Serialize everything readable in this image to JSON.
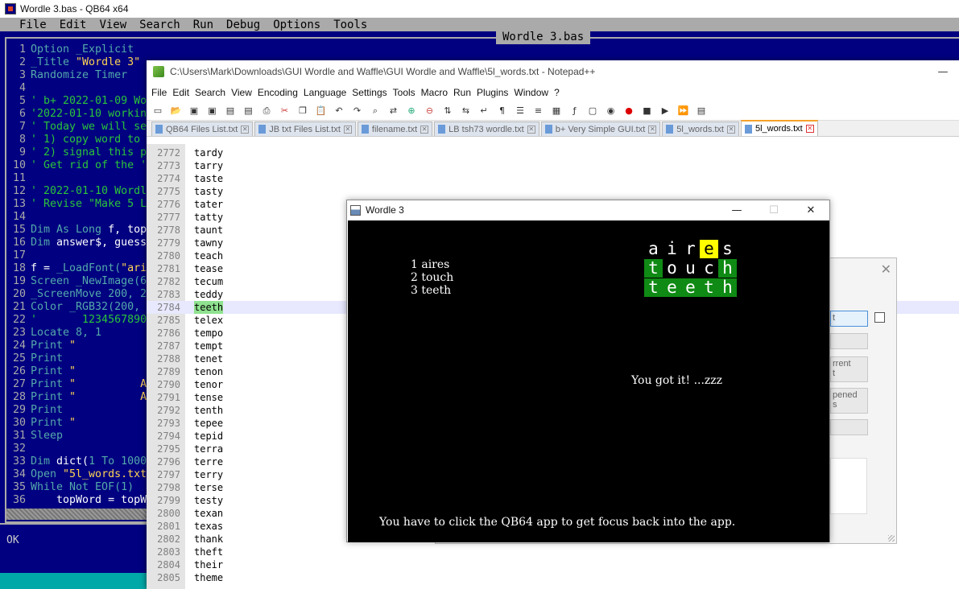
{
  "qb64": {
    "title": "Wordle 3.bas - QB64 x64",
    "menu": [
      "File",
      "Edit",
      "View",
      "Search",
      "Run",
      "Debug",
      "Options",
      "Tools"
    ],
    "file_title": "Wordle 3.bas",
    "status": "OK",
    "code_lines": [
      {
        "n": "1",
        "segs": [
          {
            "c": "kw",
            "t": "Option _Explicit"
          }
        ]
      },
      {
        "n": "2",
        "segs": [
          {
            "c": "kw",
            "t": "_Title "
          },
          {
            "c": "st",
            "t": "\"Wordle 3\""
          }
        ]
      },
      {
        "n": "3",
        "segs": [
          {
            "c": "kw",
            "t": "Randomize Timer"
          }
        ]
      },
      {
        "n": "4",
        "segs": []
      },
      {
        "n": "5",
        "segs": [
          {
            "c": "cm",
            "t": "' b+ 2022-01-09 Wo"
          }
        ]
      },
      {
        "n": "6",
        "segs": [
          {
            "c": "cm",
            "t": "'2022-01-10 workin"
          }
        ]
      },
      {
        "n": "7",
        "segs": [
          {
            "c": "cm",
            "t": "' Today we will se"
          }
        ]
      },
      {
        "n": "8",
        "segs": [
          {
            "c": "cm",
            "t": "' 1) copy word to"
          }
        ]
      },
      {
        "n": "9",
        "segs": [
          {
            "c": "cm",
            "t": "' 2) signal this p"
          }
        ]
      },
      {
        "n": "10",
        "segs": [
          {
            "c": "cm",
            "t": "' Get rid of the '"
          }
        ]
      },
      {
        "n": "11",
        "segs": []
      },
      {
        "n": "12",
        "segs": [
          {
            "c": "cm",
            "t": "' 2022-01-10 Wordl"
          }
        ]
      },
      {
        "n": "13",
        "segs": [
          {
            "c": "cm",
            "t": "' Revise \"Make 5 L"
          }
        ]
      },
      {
        "n": "14",
        "segs": []
      },
      {
        "n": "15",
        "segs": [
          {
            "c": "kw",
            "t": "Dim As Long "
          },
          {
            "c": "nm",
            "t": "f, top"
          }
        ]
      },
      {
        "n": "16",
        "segs": [
          {
            "c": "kw",
            "t": "Dim "
          },
          {
            "c": "nm",
            "t": "answer$, guess"
          }
        ]
      },
      {
        "n": "17",
        "segs": []
      },
      {
        "n": "18",
        "segs": [
          {
            "c": "nm",
            "t": "f = "
          },
          {
            "c": "kw",
            "t": "_LoadFont("
          },
          {
            "c": "st",
            "t": "\"ari"
          }
        ]
      },
      {
        "n": "19",
        "segs": [
          {
            "c": "kw",
            "t": "Screen _NewImage(6"
          }
        ]
      },
      {
        "n": "20",
        "segs": [
          {
            "c": "kw",
            "t": "_ScreenMove 200, 2"
          }
        ]
      },
      {
        "n": "21",
        "segs": [
          {
            "c": "kw",
            "t": "Color _RGB32(200, "
          }
        ]
      },
      {
        "n": "22",
        "segs": [
          {
            "c": "cm",
            "t": "'       12345678901"
          }
        ]
      },
      {
        "n": "23",
        "segs": [
          {
            "c": "kw",
            "t": "Locate 8, 1"
          }
        ]
      },
      {
        "n": "24",
        "segs": [
          {
            "c": "kw",
            "t": "Print "
          },
          {
            "c": "st",
            "t": "\""
          }
        ]
      },
      {
        "n": "25",
        "segs": [
          {
            "c": "kw",
            "t": "Print"
          }
        ]
      },
      {
        "n": "26",
        "segs": [
          {
            "c": "kw",
            "t": "Print "
          },
          {
            "c": "st",
            "t": "\""
          }
        ]
      },
      {
        "n": "27",
        "segs": [
          {
            "c": "kw",
            "t": "Print "
          },
          {
            "c": "st",
            "t": "\"          A"
          }
        ]
      },
      {
        "n": "28",
        "segs": [
          {
            "c": "kw",
            "t": "Print "
          },
          {
            "c": "st",
            "t": "\"          A"
          }
        ]
      },
      {
        "n": "29",
        "segs": [
          {
            "c": "kw",
            "t": "Print"
          }
        ]
      },
      {
        "n": "30",
        "segs": [
          {
            "c": "kw",
            "t": "Print "
          },
          {
            "c": "st",
            "t": "\""
          }
        ]
      },
      {
        "n": "31",
        "segs": [
          {
            "c": "kw",
            "t": "Sleep"
          }
        ]
      },
      {
        "n": "32",
        "segs": []
      },
      {
        "n": "33",
        "segs": [
          {
            "c": "kw",
            "t": "Dim "
          },
          {
            "c": "nm",
            "t": "dict("
          },
          {
            "c": "kw",
            "t": "1 To 1000"
          }
        ]
      },
      {
        "n": "34",
        "segs": [
          {
            "c": "kw",
            "t": "Open "
          },
          {
            "c": "st",
            "t": "\"5l_words.txt"
          }
        ]
      },
      {
        "n": "35",
        "segs": [
          {
            "c": "kw",
            "t": "While Not EOF(1)"
          }
        ]
      },
      {
        "n": "36",
        "segs": [
          {
            "c": "nm",
            "t": "    topWord = topW"
          }
        ]
      }
    ]
  },
  "npp": {
    "title": "C:\\Users\\Mark\\Downloads\\GUI Wordle and Waffle\\GUI Wordle and Waffle\\5l_words.txt - Notepad++",
    "minimize": "—",
    "menu": [
      "File",
      "Edit",
      "Search",
      "View",
      "Encoding",
      "Language",
      "Settings",
      "Tools",
      "Macro",
      "Run",
      "Plugins",
      "Window",
      "?"
    ],
    "toolbar_icons": [
      "new-icon",
      "open-icon",
      "save-icon",
      "save-all-icon",
      "close-icon",
      "close-all-icon",
      "print-icon",
      "cut-icon",
      "copy-icon",
      "paste-icon",
      "undo-icon",
      "redo-icon",
      "find-icon",
      "replace-icon",
      "zoom-in-icon",
      "zoom-out-icon",
      "sync-v-icon",
      "sync-h-icon",
      "wrap-icon",
      "all-chars-icon",
      "indent-guide-icon",
      "lang-icon",
      "doc-map-icon",
      "func-list-icon",
      "folder-icon",
      "monitor-icon",
      "record-icon",
      "stop-icon",
      "play-icon",
      "play-multi-icon",
      "save-macro-icon"
    ],
    "tabs": [
      {
        "label": "QB64 Files List.txt",
        "active": false
      },
      {
        "label": "JB txt Files List.txt",
        "active": false
      },
      {
        "label": "filename.txt",
        "active": false
      },
      {
        "label": "LB tsh73 wordle.txt",
        "active": false
      },
      {
        "label": "b+ Very Simple GUI.txt",
        "active": false
      },
      {
        "label": "5l_words.txt",
        "active": false
      },
      {
        "label": "5l_words.txt",
        "active": true
      }
    ],
    "first_line": 2772,
    "current_line": 2784,
    "lines": [
      "tardy",
      "tarry",
      "taste",
      "tasty",
      "tater",
      "tatty",
      "taunt",
      "tawny",
      "teach",
      "tease",
      "tecum",
      "teddy",
      "teeth",
      "telex",
      "tempo",
      "tempt",
      "tenet",
      "tenon",
      "tenor",
      "tense",
      "tenth",
      "tepee",
      "tepid",
      "terra",
      "terre",
      "terry",
      "terse",
      "testy",
      "texan",
      "texas",
      "thank",
      "theft",
      "their",
      "theme"
    ]
  },
  "dialog": {
    "buttons": [
      "t",
      "",
      "rrent\nt",
      "pened\ns",
      ""
    ]
  },
  "wordle": {
    "title": "Wordle 3",
    "guesses": [
      "1 aires",
      "2 touch",
      "3 teeth"
    ],
    "grid": [
      {
        "letters": [
          "a",
          "i",
          "r",
          "e",
          "s"
        ],
        "marks": [
          "none",
          "none",
          "none",
          "yellow",
          "none"
        ]
      },
      {
        "letters": [
          "t",
          "o",
          "u",
          "c",
          "h"
        ],
        "marks": [
          "green",
          "none",
          "none",
          "none",
          "green"
        ]
      },
      {
        "letters": [
          "t",
          "e",
          "e",
          "t",
          "h"
        ],
        "marks": [
          "green",
          "green",
          "green",
          "green",
          "green"
        ]
      }
    ],
    "message": "You got it! ...zzz",
    "footer": "You have to click the QB64 app to get focus back into the app.",
    "colors": {
      "green": "#0f8a14",
      "yellow": "#ffff00"
    }
  }
}
